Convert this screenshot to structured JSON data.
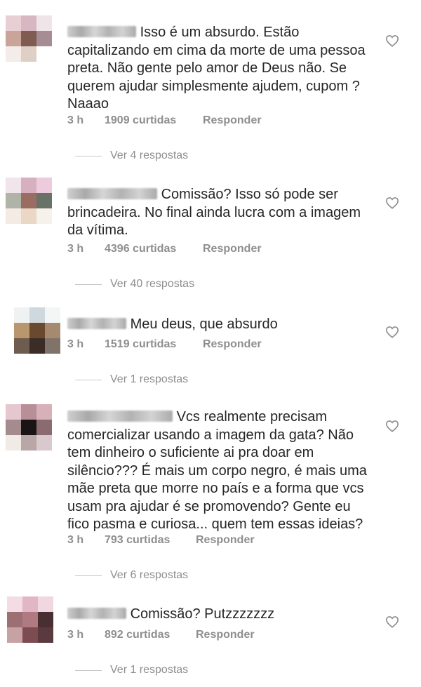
{
  "comments": [
    {
      "text": "Isso é um absurdo. Estão capitalizando em cima da morte de uma pessoa preta. Não gente pelo amor de Deus não. Se querem ajudar simplesmente ajudem, cupom ? Naaao",
      "time": "3 h",
      "likes": "1909 curtidas",
      "reply": "Responder",
      "view_replies": "Ver 4 respostas"
    },
    {
      "text": "Comissão? Isso só pode ser brincadeira. No final ainda lucra com a imagem da vítima.",
      "time": "3 h",
      "likes": "4396 curtidas",
      "reply": "Responder",
      "view_replies": "Ver 40 respostas"
    },
    {
      "text": "Meu deus, que absurdo",
      "time": "3 h",
      "likes": "1519 curtidas",
      "reply": "Responder",
      "view_replies": "Ver 1 respostas"
    },
    {
      "text": "Vcs realmente precisam comercializar usando a imagem da gata? Não tem dinheiro o suficiente ai pra doar em silêncio??? É mais um corpo negro, é mais uma mãe preta que morre no país e a forma que vcs usam pra ajudar é se promovendo? Gente eu fico pasma e curiosa... quem tem essas ideias?",
      "time": "3 h",
      "likes": "793 curtidas",
      "reply": "Responder",
      "view_replies": "Ver 6 respostas"
    },
    {
      "text": "Comissão? Putzzzzzzz",
      "time": "3 h",
      "likes": "892 curtidas",
      "reply": "Responder",
      "view_replies": "Ver 1 respostas"
    }
  ],
  "icons": {
    "like": "heart-outline-icon"
  },
  "colors": {
    "text": "#262626",
    "secondary": "#8e8e8e",
    "divider": "#c7c7c7"
  }
}
